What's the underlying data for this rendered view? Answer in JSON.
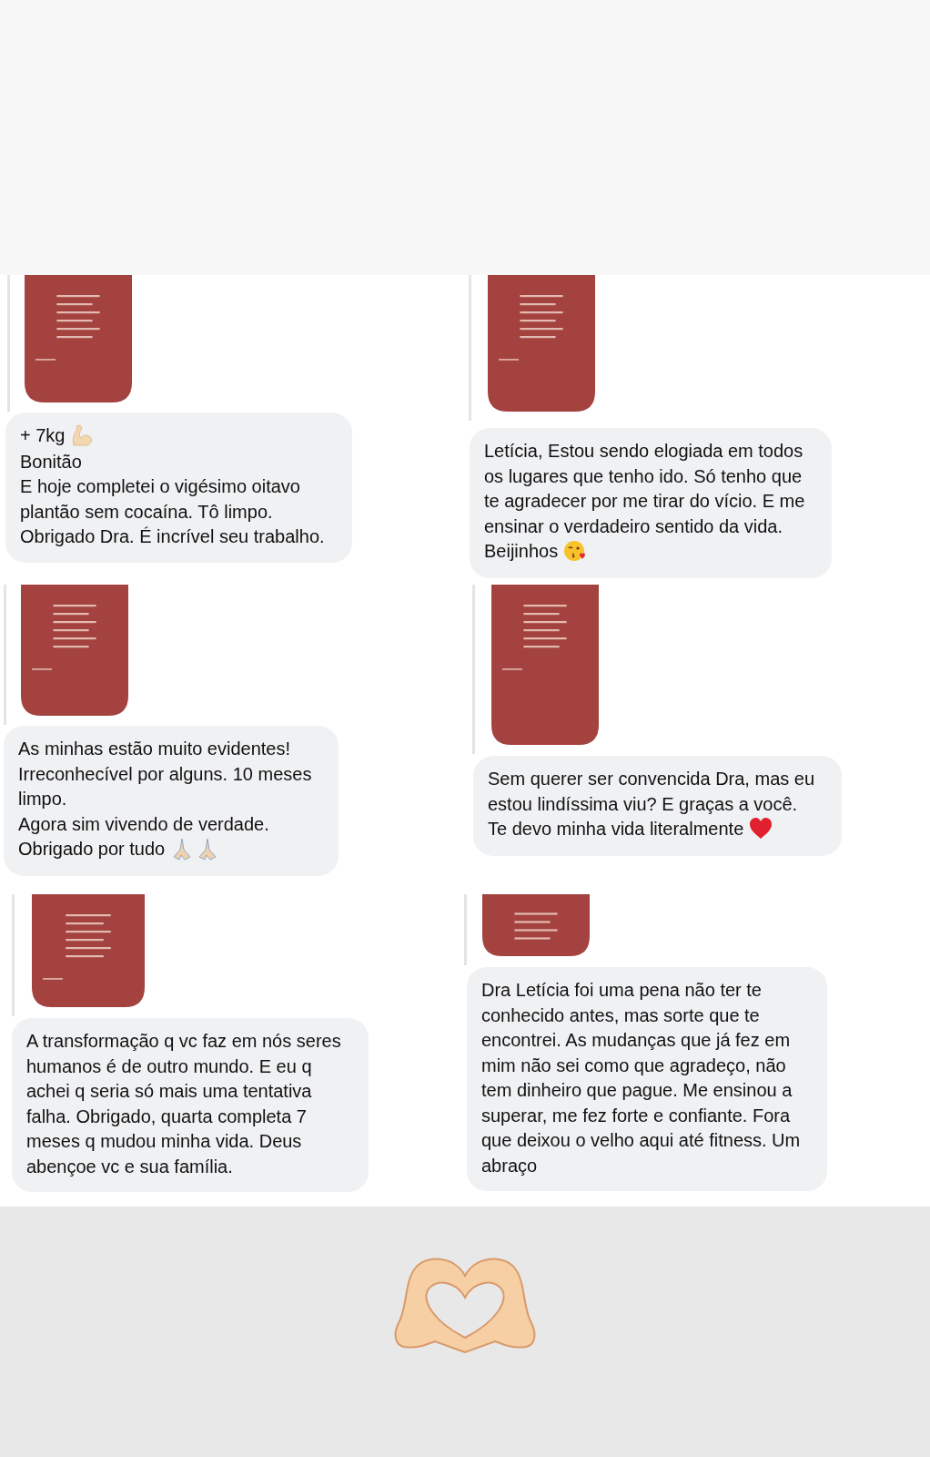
{
  "messages": [
    {
      "parts": [
        {
          "kind": "text",
          "text": "+ 7kg"
        },
        {
          "kind": "muscle"
        },
        {
          "kind": "text",
          "text": "Bonitão\nE hoje completei o vigésimo oitavo\nplantão sem cocaína. Tô limpo.\nObrigado Dra. É incrível seu trabalho."
        }
      ]
    },
    {
      "parts": [
        {
          "kind": "text",
          "text": "Letícia, Estou sendo elogiada em todos\nos lugares que tenho ido. Só tenho que\nte agradecer por me tirar do vício. E me\nensinar o verdadeiro sentido da vida."
        },
        {
          "kind": "text",
          "text": "Beijinhos"
        },
        {
          "kind": "kiss"
        }
      ]
    },
    {
      "parts": [
        {
          "kind": "text",
          "text": "As minhas estão muito evidentes!\nIrreconhecível por alguns. 10 meses\nlimpo.\nAgora sim vivendo de verdade."
        },
        {
          "kind": "text",
          "text": "Obrigado por tudo"
        },
        {
          "kind": "pray"
        }
      ]
    },
    {
      "parts": [
        {
          "kind": "text",
          "text": "Sem querer ser convencida Dra, mas eu\nestou lindíssima viu? E graças a você."
        },
        {
          "kind": "text",
          "text": "Te devo minha vida literalmente"
        },
        {
          "kind": "heart"
        }
      ]
    },
    {
      "parts": [
        {
          "kind": "text",
          "text": "A transformação q vc faz em nós seres\nhumanos é de outro mundo. E eu q\nachei q seria só mais uma tentativa\nfalha. Obrigado, quarta completa 7\nmeses q mudou minha vida. Deus\nabençoe vc e sua família."
        }
      ]
    },
    {
      "parts": [
        {
          "kind": "text",
          "text": "Dra Letícia foi uma pena não ter te\nconhecido antes, mas sorte que te\nencontrei. As mudanças que já fez em\nmim não sei como que agradeço, não\ntem dinheiro que pague. Me ensinou a\nsuperar, me fez forte e confiante. Fora\nque deixou o velho aqui até fitness. Um\nabraço"
        }
      ]
    }
  ],
  "footer": {
    "kind": "heart-hands"
  }
}
